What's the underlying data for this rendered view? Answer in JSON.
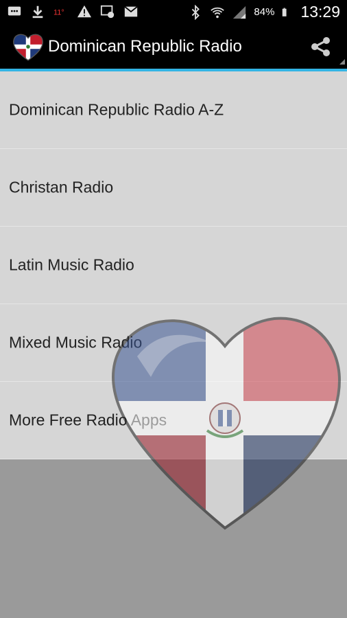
{
  "status_bar": {
    "battery_percent": "84%",
    "clock": "13:29",
    "left_icons": [
      "message-icon",
      "download-icon",
      "thermometer-icon",
      "warning-icon",
      "notification-icon",
      "mail-icon"
    ],
    "right_icons": [
      "bluetooth-icon",
      "wifi-icon",
      "signal-icon",
      "battery-icon"
    ]
  },
  "app_bar": {
    "title": "Dominican Republic Radio",
    "accent_color": "#33b5e5"
  },
  "menu": {
    "items": [
      {
        "label": "Dominican Republic Radio A-Z"
      },
      {
        "label": "Christan Radio"
      },
      {
        "label": "Latin Music Radio"
      },
      {
        "label": "Mixed Music Radio"
      },
      {
        "label": "More Free Radio Apps"
      }
    ]
  }
}
